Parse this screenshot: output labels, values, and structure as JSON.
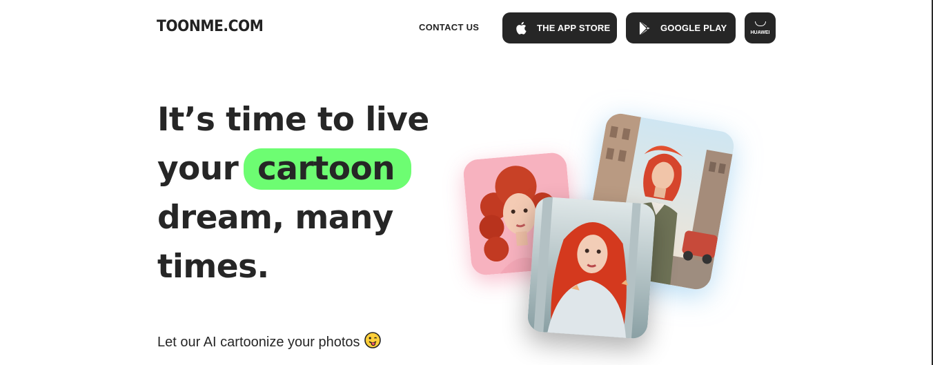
{
  "header": {
    "logo_text": "TOONME.COM",
    "contact_label": "CONTACT US",
    "app_store_label": "THE APP STORE",
    "google_play_label": "GOOGLE PLAY",
    "huawei_label": "HUAWEI"
  },
  "hero": {
    "headline_line1": "It’s time to live",
    "headline_line2_prefix": "your",
    "headline_highlight": "cartoon",
    "headline_line3": "dream, many",
    "headline_line4": "times.",
    "subtext": "Let our AI cartoonize your photos"
  },
  "colors": {
    "highlight": "#6dfd72",
    "button_bg": "#262626",
    "text": "#262626"
  },
  "icons": [
    "apple-icon",
    "google-play-icon",
    "huawei-bag-icon",
    "tongue-emoji-icon"
  ]
}
